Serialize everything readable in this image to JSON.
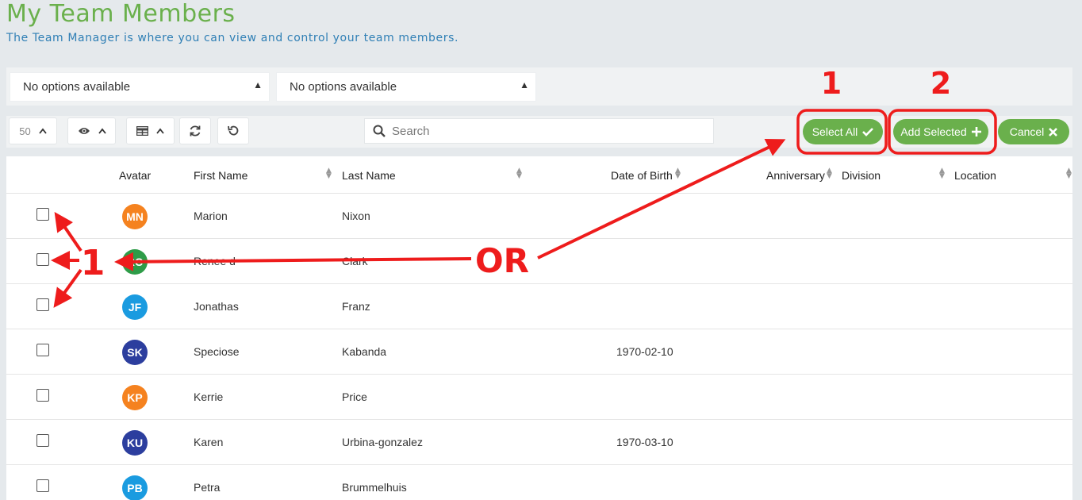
{
  "header": {
    "title": "My Team Members",
    "subtitle": "The Team Manager is where you can view and control your team members."
  },
  "filters": [
    {
      "value": "No options available"
    },
    {
      "value": "No options available"
    }
  ],
  "toolbar": {
    "page_size": "50",
    "search_placeholder": "Search",
    "select_all_label": "Select All",
    "add_selected_label": "Add Selected",
    "cancel_label": "Cancel"
  },
  "table": {
    "columns": [
      "Avatar",
      "First Name",
      "Last Name",
      "Date of Birth",
      "Anniversary",
      "Division",
      "Location"
    ],
    "rows": [
      {
        "initials": "MN",
        "color": "#f5821f",
        "first": "Marion",
        "last": "Nixon",
        "dob": ""
      },
      {
        "initials": "RC",
        "color": "#2e9c48",
        "first": "Renee d",
        "last": "Clark",
        "dob": ""
      },
      {
        "initials": "JF",
        "color": "#1a9be0",
        "first": "Jonathas",
        "last": "Franz",
        "dob": ""
      },
      {
        "initials": "SK",
        "color": "#2c3e9e",
        "first": "Speciose",
        "last": "Kabanda",
        "dob": "1970-02-10"
      },
      {
        "initials": "KP",
        "color": "#f5821f",
        "first": "Kerrie",
        "last": "Price",
        "dob": ""
      },
      {
        "initials": "KU",
        "color": "#2c3e9e",
        "first": "Karen",
        "last": "Urbina-gonzalez",
        "dob": "1970-03-10"
      },
      {
        "initials": "PB",
        "color": "#1a9be0",
        "first": "Petra",
        "last": "Brummelhuis",
        "dob": ""
      }
    ]
  },
  "annotations": {
    "step_one": "1",
    "step_two": "2",
    "step_one_left": "1",
    "or_label": "OR"
  },
  "colors": {
    "accent": "#6ab04c",
    "annotation": "#ee1c1c"
  }
}
